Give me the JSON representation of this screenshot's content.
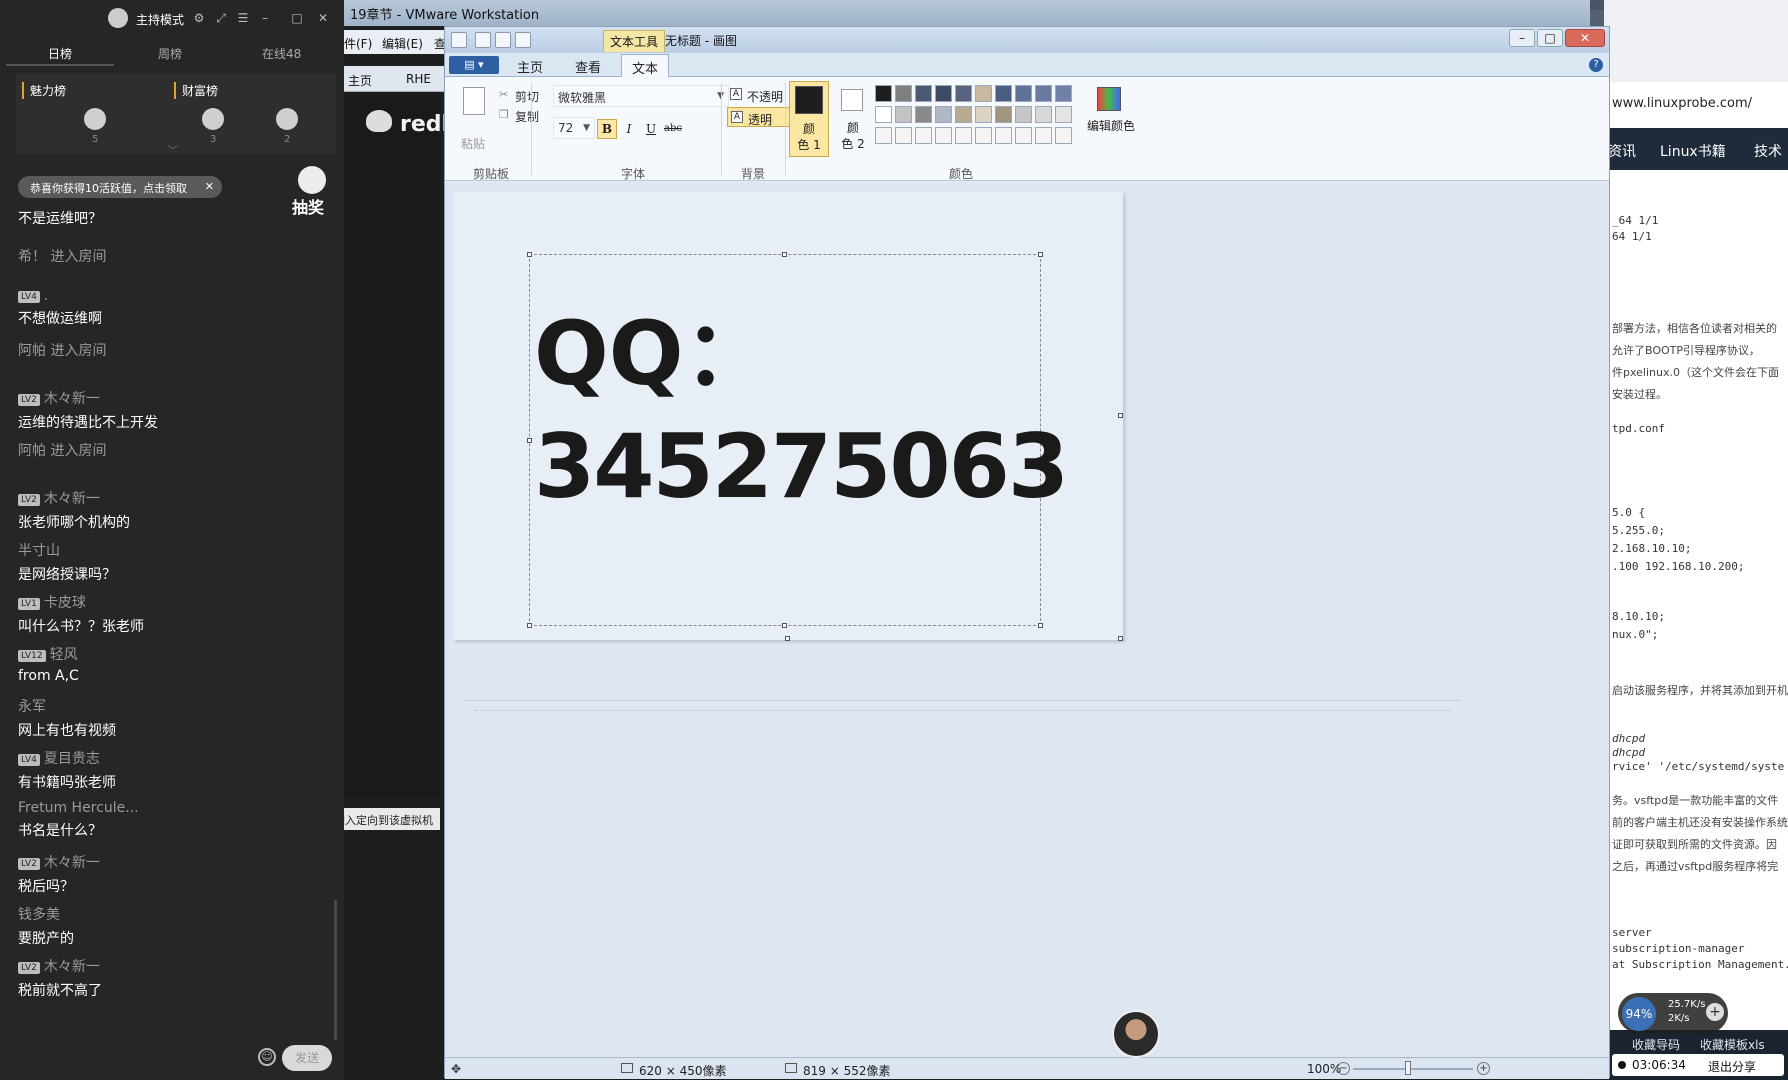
{
  "vmware": {
    "title": "19章节 - VMware Workstation",
    "menu": [
      "文件(F)",
      "编辑(E)",
      "查"
    ],
    "tabs": [
      "主页",
      "RHE"
    ],
    "guest_brand": "redh",
    "status_text": "输入定向到该虚拟机"
  },
  "browser": {
    "url": "www.linuxprobe.com/",
    "nav": [
      "资讯",
      "Linux书籍",
      "技术"
    ],
    "lines": [
      {
        "text": "_64 1/1",
        "mono": true
      },
      {
        "text": "64 1/1",
        "mono": true
      },
      {
        "text": "部署方法，相信各位读者对相关的",
        "mono": false
      },
      {
        "text": "允许了BOOTP引导程序协议，",
        "mono": false
      },
      {
        "text": "件pxelinux.0（这个文件会在下面",
        "mono": false
      },
      {
        "text": "安装过程。",
        "mono": false
      },
      {
        "text": "tpd.conf",
        "mono": true
      },
      {
        "text": "5.0 {",
        "mono": true
      },
      {
        "text": "5.255.0;",
        "mono": true
      },
      {
        "text": "2.168.10.10;",
        "mono": true
      },
      {
        "text": ".100 192.168.10.200;",
        "mono": true
      },
      {
        "text": "8.10.10;",
        "mono": true
      },
      {
        "text": "nux.0\";",
        "mono": true
      },
      {
        "text": "启动该服务程序，并将其添加到开机",
        "mono": false
      },
      {
        "text": "dhcpd",
        "mono": true,
        "italic": true
      },
      {
        "text": "dhcpd",
        "mono": true,
        "italic": true
      },
      {
        "text": "rvice' '/etc/systemd/syste",
        "mono": true
      },
      {
        "text": "务。vsftpd是一款功能丰富的文件",
        "mono": false
      },
      {
        "text": "前的客户端主机还没有安装操作系统",
        "mono": false
      },
      {
        "text": "证即可获取到所需的文件资源。因",
        "mono": false
      },
      {
        "text": "之后，再通过vsftpd服务程序将完",
        "mono": false
      },
      {
        "text": "server",
        "mono": true
      },
      {
        "text": "subscription-manager",
        "mono": true
      },
      {
        "text": "at Subscription Management.",
        "mono": true
      }
    ],
    "bottom_links": [
      "收藏导码",
      "收藏模板xls"
    ],
    "net": {
      "percent": "94%",
      "up": "25.7K/s",
      "down": "2K/s",
      "plus": "+"
    },
    "share": {
      "timer": "03:06:34",
      "exit": "退出分享"
    }
  },
  "paint": {
    "context_tab": "文本工具",
    "title": "无标题 - 画图",
    "window_buttons": {
      "min": "–",
      "max": "□",
      "close": "✕"
    },
    "file_button": "▤ ▾",
    "tabs": [
      "主页",
      "查看",
      "文本"
    ],
    "active_tab": "文本",
    "help": "?",
    "clipboard": {
      "paste": "粘贴",
      "cut": "剪切",
      "copy": "复制",
      "label": "剪贴板"
    },
    "font": {
      "family": "微软雅黑",
      "size": "72",
      "bold": "B",
      "italic": "I",
      "underline": "U",
      "strike": "abc",
      "label": "字体"
    },
    "background": {
      "opaque": "不透明",
      "transparent": "透明",
      "label": "背景"
    },
    "colors": {
      "color1_line1": "颜",
      "color1_line2": "色 1",
      "color2_line1": "颜",
      "color2_line2": "色 2",
      "edit": "编辑颜色",
      "label": "颜色",
      "color1": "#1e1e1e",
      "color2": "#ffffff",
      "palette": [
        "#1e1e1e",
        "#7f7f7f",
        "#4a5a74",
        "#3d4c66",
        "#58617d",
        "#c8b8a0",
        "#4c5e80",
        "#5f7396",
        "#6a7aa0",
        "#7080a8",
        "#ffffff",
        "#c3c3c3",
        "#8a8a8a",
        "#b0b8c8",
        "#b9a98f",
        "#dcd3c2",
        "#a29580",
        "#c6c6c6",
        "#d8d8d8",
        "#e4e4e4",
        "#f4f4f4",
        "#f4f4f4",
        "#f4f4f4",
        "#f4f4f4",
        "#f4f4f4",
        "#f4f4f4",
        "#f4f4f4",
        "#f4f4f4",
        "#f4f4f4",
        "#f4f4f4"
      ]
    },
    "canvas_text": {
      "line1": "QQ：",
      "line2": "345275063"
    },
    "status": {
      "move_icon": "✥",
      "selection_size": "620 × 450像素",
      "canvas_size": "819 × 552像素",
      "zoom": "100%",
      "zoom_minus": "−",
      "zoom_plus": "+"
    }
  },
  "chat": {
    "host_mode": "主持模式",
    "header_icons": [
      "⚙",
      "⤢",
      "☰",
      "–",
      "□",
      "✕"
    ],
    "rank_tabs": [
      "日榜",
      "周榜",
      "在线48"
    ],
    "boards": {
      "charm": "魅力榜",
      "wealth": "财富榜",
      "ranks": [
        "5",
        "3",
        "2"
      ],
      "chevron": "﹀"
    },
    "reward_toast": {
      "text": "恭喜你获得10活跃值，点击领取",
      "close": "✕"
    },
    "lottery": "抽奖",
    "messages": [
      {
        "user": "",
        "level": "",
        "text": "不是运维吧？"
      },
      {
        "system": "希！ 进入房间"
      },
      {
        "user": ".",
        "level": "LV4",
        "text": "不想做运维啊"
      },
      {
        "system": "阿帕 进入房间"
      },
      {
        "user": "木々新一",
        "level": "LV2",
        "text": "运维的待遇比不上开发"
      },
      {
        "system": "阿帕 进入房间"
      },
      {
        "user": "木々新一",
        "level": "LV2",
        "text": "张老师哪个机构的"
      },
      {
        "user": "半寸山",
        "level": "",
        "text": "是网络授课吗？"
      },
      {
        "user": "卡皮球",
        "level": "LV1",
        "text": "叫什么书？？张老师"
      },
      {
        "user": "轻风",
        "level": "LV12",
        "text": "from A,C"
      },
      {
        "user": "永军",
        "level": "",
        "text": "网上有也有视频"
      },
      {
        "user": "夏目贵志",
        "level": "LV4",
        "text": "有书籍吗张老师"
      },
      {
        "user": "Fretum Hercule...",
        "level": "",
        "text": "书名是什么？"
      },
      {
        "user": "木々新一",
        "level": "LV2",
        "text": "税后吗？"
      },
      {
        "user": "钱多美",
        "level": "",
        "text": "要脱产的"
      },
      {
        "user": "木々新一",
        "level": "LV2",
        "text": "税前就不高了"
      }
    ],
    "emoji": "☺",
    "send": "发送"
  }
}
